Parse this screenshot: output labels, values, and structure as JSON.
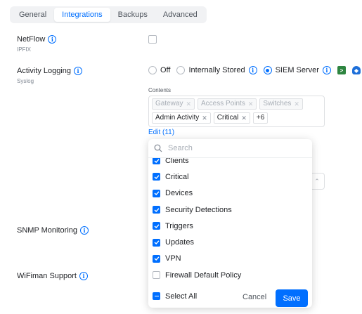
{
  "tabs": [
    {
      "label": "General",
      "active": false
    },
    {
      "label": "Integrations",
      "active": true
    },
    {
      "label": "Backups",
      "active": false
    },
    {
      "label": "Advanced",
      "active": false
    }
  ],
  "netflow": {
    "label": "NetFlow",
    "sub": "IPFIX",
    "enabled": false
  },
  "activity_logging": {
    "label": "Activity Logging",
    "sub": "Syslog",
    "options": [
      {
        "label": "Off",
        "selected": false
      },
      {
        "label": "Internally Stored",
        "selected": false
      },
      {
        "label": "SIEM Server",
        "selected": true
      }
    ],
    "contents_label": "Contents",
    "chips_disabled": [
      "Gateway",
      "Access Points",
      "Switches"
    ],
    "chips_active": [
      "Admin Activity",
      "Critical"
    ],
    "more_count": "+6",
    "edit_label": "Edit (11)"
  },
  "snmp": {
    "label": "SNMP Monitoring"
  },
  "wifiman": {
    "label": "WiFiman Support"
  },
  "dropdown": {
    "search_placeholder": "Search",
    "options": [
      {
        "label": "Clients",
        "checked": true
      },
      {
        "label": "Critical",
        "checked": true
      },
      {
        "label": "Devices",
        "checked": true
      },
      {
        "label": "Security Detections",
        "checked": true
      },
      {
        "label": "Triggers",
        "checked": true
      },
      {
        "label": "Updates",
        "checked": true
      },
      {
        "label": "VPN",
        "checked": true
      },
      {
        "label": "Firewall Default Policy",
        "checked": false
      }
    ],
    "select_all_label": "Select All",
    "cancel_label": "Cancel",
    "save_label": "Save"
  },
  "colors": {
    "accent": "#006fff",
    "app_green": "#2e8540",
    "app_blue": "#1e6fd9",
    "app_lime": "#a6d14d"
  }
}
